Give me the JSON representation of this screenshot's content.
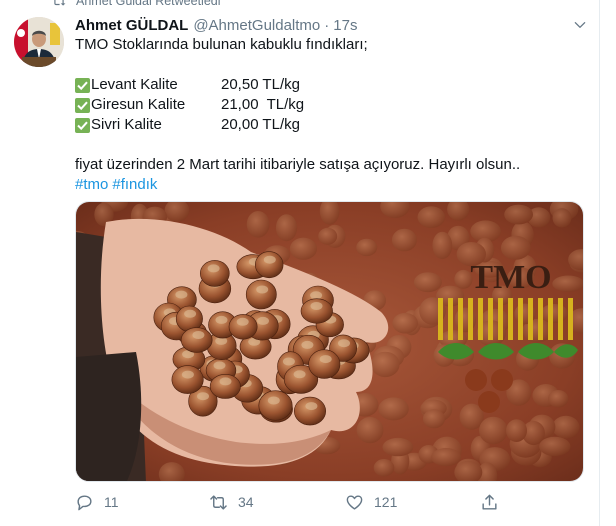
{
  "retweet": {
    "label": "Ahmet Güldal Retweetledi",
    "icon": "retweet-icon"
  },
  "author": {
    "name": "Ahmet GÜLDAL",
    "handle": "@AhmetGuldaltmo",
    "separator": "·",
    "time": "17s"
  },
  "tweet": {
    "intro": "TMO Stoklarında bulunan kabuklu fındıkları;",
    "products": [
      {
        "name": "Levant Kalite",
        "price": "20,50 TL/kg"
      },
      {
        "name": "Giresun Kalite",
        "price": "21,00  TL/kg"
      },
      {
        "name": "Sivri Kalite",
        "price": "20,00 TL/kg"
      }
    ],
    "closing": "fiyat üzerinden 2 Mart tarihi itibariyle satışa açıyoruz. Hayırlı olsun..",
    "hashtags": [
      "#tmo",
      "#fındık"
    ]
  },
  "media": {
    "logo_text": "TMO"
  },
  "actions": {
    "reply": {
      "icon": "reply-icon",
      "count": "11"
    },
    "retweet": {
      "icon": "retweet-icon",
      "count": "34"
    },
    "like": {
      "icon": "heart-icon",
      "count": "121"
    },
    "share": {
      "icon": "share-icon"
    }
  },
  "colors": {
    "text": "#0f1419",
    "secondary": "#657786",
    "link": "#1b95e0",
    "check": "#77b255",
    "border": "#e6ecf0"
  }
}
